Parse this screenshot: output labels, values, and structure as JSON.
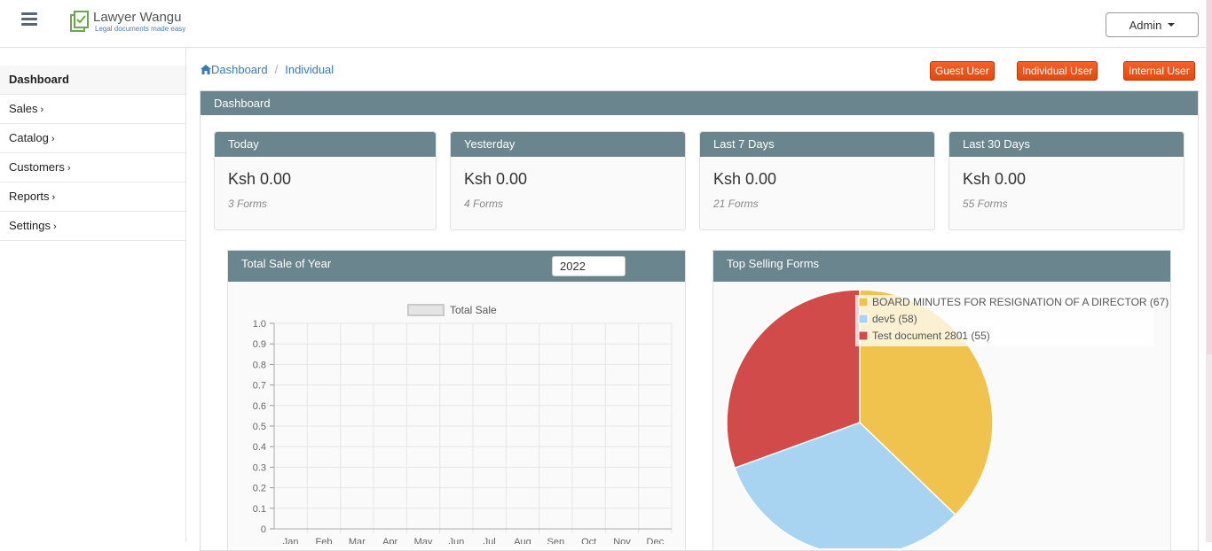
{
  "brand": {
    "name": "Lawyer Wangu",
    "tagline": "Legal documents made easy"
  },
  "header": {
    "admin_label": "Admin"
  },
  "sidebar": {
    "items": [
      {
        "label": "Dashboard",
        "chevron": ""
      },
      {
        "label": "Sales",
        "chevron": "›"
      },
      {
        "label": "Catalog",
        "chevron": "›"
      },
      {
        "label": "Customers",
        "chevron": "›"
      },
      {
        "label": "Reports",
        "chevron": "›"
      },
      {
        "label": "Settings",
        "chevron": "›"
      }
    ]
  },
  "breadcrumb": {
    "home": "Dashboard",
    "current": "Individual",
    "separator": "/"
  },
  "user_buttons": {
    "guest": "Guest User",
    "individual": "Individual User",
    "internal": "Internal User"
  },
  "dashboard": {
    "title": "Dashboard",
    "stats": [
      {
        "label": "Today",
        "amount": "Ksh 0.00",
        "forms": "3 Forms"
      },
      {
        "label": "Yesterday",
        "amount": "Ksh 0.00",
        "forms": "4 Forms"
      },
      {
        "label": "Last 7 Days",
        "amount": "Ksh 0.00",
        "forms": "21 Forms"
      },
      {
        "label": "Last 30 Days",
        "amount": "Ksh 0.00",
        "forms": "55 Forms"
      }
    ],
    "sales_panel": {
      "title": "Total Sale of Year",
      "year": "2022"
    },
    "top_panel": {
      "title": "Top Selling Forms"
    }
  },
  "colors": {
    "panel_header": "#6b858e",
    "accent_button": "#f05a22",
    "link": "#3a7ab8"
  },
  "chart_data": [
    {
      "type": "line",
      "legend": [
        "Total Sale"
      ],
      "categories": [
        "Jan",
        "Feb",
        "Mar",
        "Apr",
        "May",
        "Jun",
        "Jul",
        "Aug",
        "Sep",
        "Oct",
        "Nov",
        "Dec"
      ],
      "series": [
        {
          "name": "Total Sale",
          "values": []
        }
      ],
      "ylim": [
        0,
        1
      ],
      "yticks": [
        "0",
        "0.1",
        "0.2",
        "0.3",
        "0.4",
        "0.5",
        "0.6",
        "0.7",
        "0.8",
        "0.9",
        "1.0"
      ],
      "grid": true,
      "legend_position": "top"
    },
    {
      "type": "pie",
      "legend_position": "top-right",
      "slices": [
        {
          "label": "BOARD MINUTES FOR RESIGNATION OF A DIRECTOR (67)",
          "value": 67,
          "color": "#f0c24e"
        },
        {
          "label": "dev5 (58)",
          "value": 58,
          "color": "#a8d4f2"
        },
        {
          "label": "Test document 2801 (55)",
          "value": 55,
          "color": "#d14b4b"
        }
      ]
    }
  ]
}
